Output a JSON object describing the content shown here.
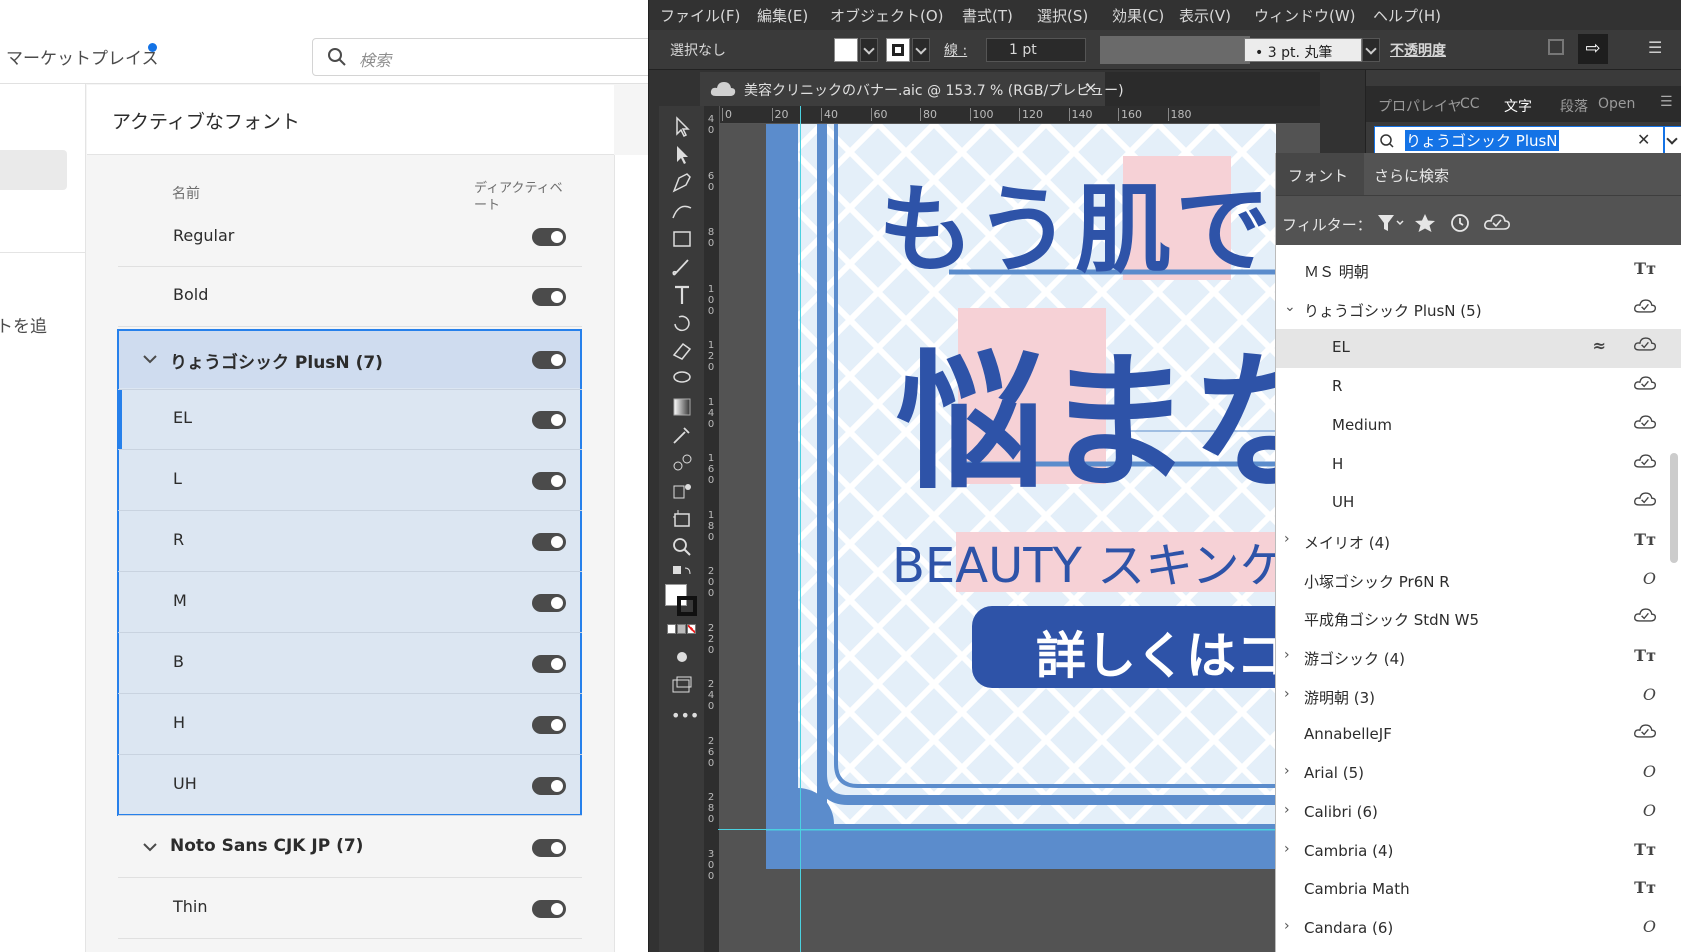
{
  "cc": {
    "marketplace": "マーケットプレイス",
    "search_placeholder": "検索",
    "sidebar_partial_text": "トを追",
    "title": "アクティブなフォント",
    "col_name": "名前",
    "col_deactivate": "ディアクティベート",
    "rows": [
      {
        "label": "Regular",
        "type": "face"
      },
      {
        "label": "Bold",
        "type": "face"
      },
      {
        "label": "りょうゴシック PlusN (7)",
        "type": "family"
      },
      {
        "label": "EL",
        "type": "face"
      },
      {
        "label": "L",
        "type": "face"
      },
      {
        "label": "R",
        "type": "face"
      },
      {
        "label": "M",
        "type": "face"
      },
      {
        "label": "B",
        "type": "face"
      },
      {
        "label": "H",
        "type": "face"
      },
      {
        "label": "UH",
        "type": "face"
      },
      {
        "label": "Noto Sans CJK JP (7)",
        "type": "family"
      },
      {
        "label": "Thin",
        "type": "face"
      }
    ]
  },
  "ai": {
    "menu": [
      "ファイル(F)",
      "編集(E)",
      "オブジェクト(O)",
      "書式(T)",
      "選択(S)",
      "効果(C)",
      "表示(V)",
      "ウィンドウ(W)",
      "ヘルプ(H)"
    ],
    "control": {
      "selection": "選択なし",
      "stroke_label": "線 :",
      "stroke_value": "1 pt",
      "brush": "• 3 pt. 丸筆",
      "opacity": "不透明度"
    },
    "doc_tab": "美容クリニックのバナー.aic @ 153.7 % (RGB/プレビュー)",
    "doc_close": "×",
    "ruler_top": [
      "0",
      "20",
      "40",
      "60",
      "80",
      "100",
      "120",
      "140",
      "160",
      "180"
    ],
    "ruler_left": [
      "40",
      "60",
      "80",
      "100",
      "120",
      "140",
      "160",
      "180",
      "200",
      "220",
      "240",
      "260",
      "280",
      "300"
    ],
    "artwork": {
      "line1": "もう肌で",
      "line2": "悩まない",
      "sub": "BEAUTY スキンケア",
      "cta": "詳しくはコチラ"
    },
    "panel_tabs": [
      "プロパ",
      "レイヤ",
      "CC",
      "文字",
      "段落",
      "Open"
    ],
    "font_search": "りょうゴシック PlusN",
    "dropdown": {
      "tab_fonts": "フォント",
      "tab_more": "さらに検索",
      "filter_label": "フィルター："
    },
    "font_list": [
      {
        "label": "ＭＳ 明朝",
        "expand": "",
        "indent": false,
        "icon": "Tt"
      },
      {
        "label": "りょうゴシック PlusN (5)",
        "expand": "open",
        "indent": false,
        "icon": "cloud"
      },
      {
        "label": "EL",
        "expand": "",
        "indent": true,
        "icon": "cloud",
        "mark": "≈"
      },
      {
        "label": "R",
        "expand": "",
        "indent": true,
        "icon": "cloud"
      },
      {
        "label": "Medium",
        "expand": "",
        "indent": true,
        "icon": "cloud"
      },
      {
        "label": "H",
        "expand": "",
        "indent": true,
        "icon": "cloud"
      },
      {
        "label": "UH",
        "expand": "",
        "indent": true,
        "icon": "cloud"
      },
      {
        "label": "メイリオ (4)",
        "expand": "closed",
        "indent": false,
        "icon": "Tt"
      },
      {
        "label": "小塚ゴシック Pr6N R",
        "expand": "",
        "indent": false,
        "icon": "O"
      },
      {
        "label": "平成角ゴシック StdN W5",
        "expand": "",
        "indent": false,
        "icon": "cloud"
      },
      {
        "label": "游ゴシック (4)",
        "expand": "closed",
        "indent": false,
        "icon": "Tt"
      },
      {
        "label": "游明朝 (3)",
        "expand": "closed",
        "indent": false,
        "icon": "O"
      },
      {
        "label": "AnnabelleJF",
        "expand": "",
        "indent": false,
        "icon": "cloud"
      },
      {
        "label": "Arial (5)",
        "expand": "closed",
        "indent": false,
        "icon": "O"
      },
      {
        "label": "Calibri (6)",
        "expand": "closed",
        "indent": false,
        "icon": "O"
      },
      {
        "label": "Cambria (4)",
        "expand": "closed",
        "indent": false,
        "icon": "Tt"
      },
      {
        "label": "Cambria Math",
        "expand": "",
        "indent": false,
        "icon": "Tt"
      },
      {
        "label": "Candara (6)",
        "expand": "closed",
        "indent": false,
        "icon": "O"
      }
    ],
    "colors": {
      "accent": "#1473e6",
      "art_blue": "#2e53a8",
      "art_pink": "#f6d1d6",
      "art_bg": "#e4eff9"
    }
  }
}
